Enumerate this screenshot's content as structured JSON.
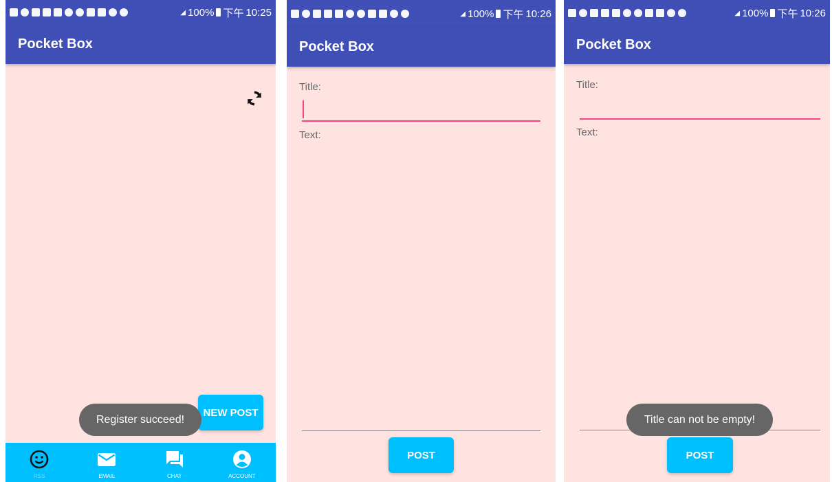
{
  "status_bars": [
    {
      "battery": "100%",
      "ampm": "下午",
      "time": "10:25"
    },
    {
      "battery": "100%",
      "ampm": "下午",
      "time": "10:26"
    },
    {
      "battery": "100%",
      "ampm": "下午",
      "time": "10:26"
    }
  ],
  "app_title": "Pocket Box",
  "screen1": {
    "new_post_label": "NEW POST",
    "toast": "Register succeed!",
    "nav": [
      {
        "label": "RSS",
        "icon": "smiley-icon"
      },
      {
        "label": "EMAIL",
        "icon": "email-icon"
      },
      {
        "label": "CHAT",
        "icon": "chat-icon"
      },
      {
        "label": "ACCOUNT",
        "icon": "account-icon"
      }
    ]
  },
  "screen2": {
    "title_label": "Title:",
    "title_value": "",
    "text_label": "Text:",
    "post_label": "POST"
  },
  "screen3": {
    "title_label": "Title:",
    "title_value": "",
    "text_label": "Text:",
    "post_label": "POST",
    "toast": "Title can not be empty!"
  },
  "colors": {
    "primary": "#3f4fb5",
    "accent": "#00bfff",
    "background": "#ffe3e0",
    "input_underline": "#ff4081",
    "toast": "#666666"
  }
}
